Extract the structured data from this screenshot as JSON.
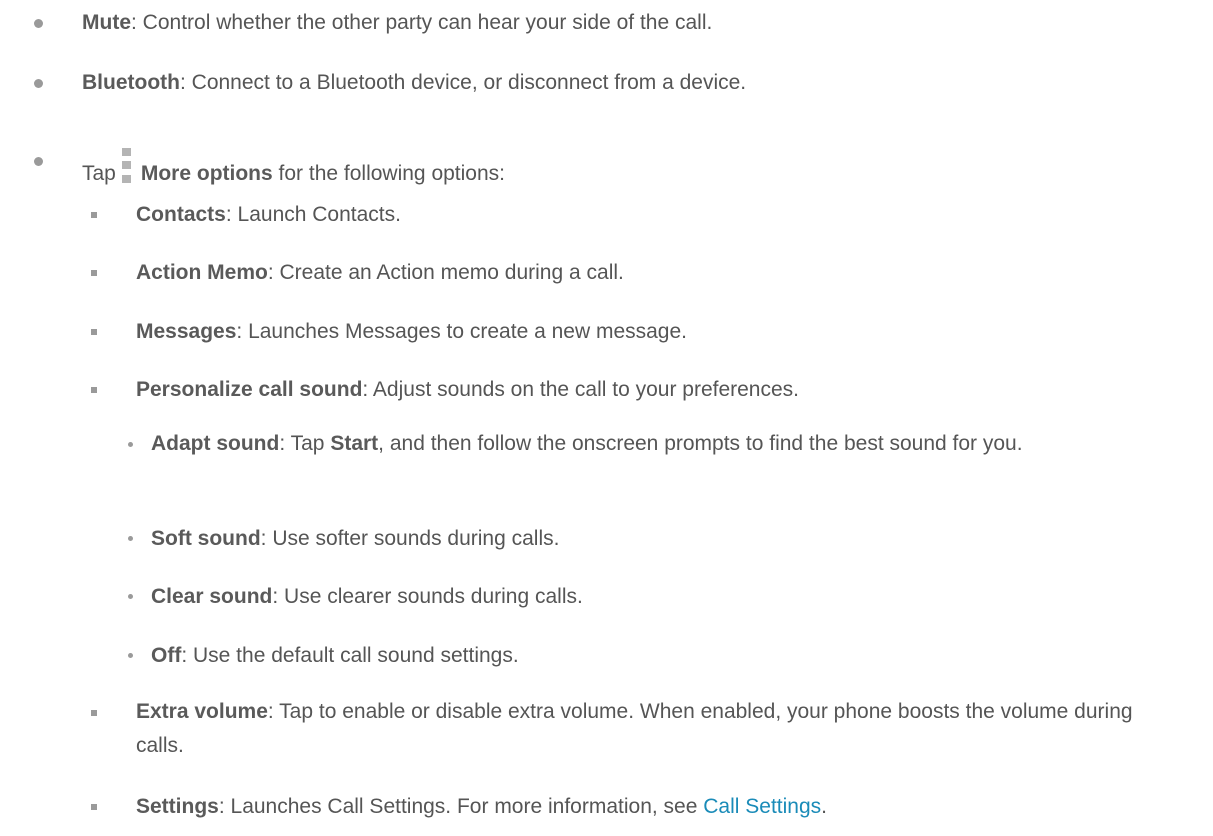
{
  "items": {
    "mute": {
      "label": "Mute",
      "desc": ": Control whether the other party can hear your side of the call."
    },
    "bluetooth": {
      "label": "Bluetooth",
      "desc": ": Connect to a Bluetooth device, or disconnect from a device."
    },
    "more": {
      "prefix": "Tap",
      "label": "More options",
      "suffix": " for the following options:",
      "icon": "more-options-icon"
    },
    "contacts": {
      "label": "Contacts",
      "desc": ": Launch Contacts."
    },
    "action_memo": {
      "label": "Action Memo",
      "desc": ": Create an Action memo during a call."
    },
    "messages": {
      "label": "Messages",
      "desc": ": Launches Messages to create a new message."
    },
    "personalize": {
      "label": "Personalize call sound",
      "desc": ": Adjust sounds on the call to your preferences."
    },
    "adapt": {
      "label": "Adapt sound",
      "desc_a": ": Tap ",
      "start": "Start",
      "desc_b": ", and then follow the onscreen prompts to find the best sound for you."
    },
    "soft": {
      "label": "Soft sound",
      "desc": ": Use softer sounds during calls."
    },
    "clear": {
      "label": "Clear sound",
      "desc": ": Use clearer sounds during calls."
    },
    "off": {
      "label": "Off",
      "desc": ": Use the default call sound settings."
    },
    "extra_volume": {
      "label": "Extra volume",
      "desc": ": Tap to enable or disable extra volume. When enabled, your phone boosts the volume during calls."
    },
    "settings": {
      "label": "Settings",
      "desc": ": Launches Call Settings. For more information, see ",
      "link": "Call Settings",
      "end": "."
    }
  },
  "colors": {
    "text": "#555555",
    "link": "#1a8bb8",
    "bullet": "#9a9a9a",
    "icon": "#b4b4b4"
  }
}
